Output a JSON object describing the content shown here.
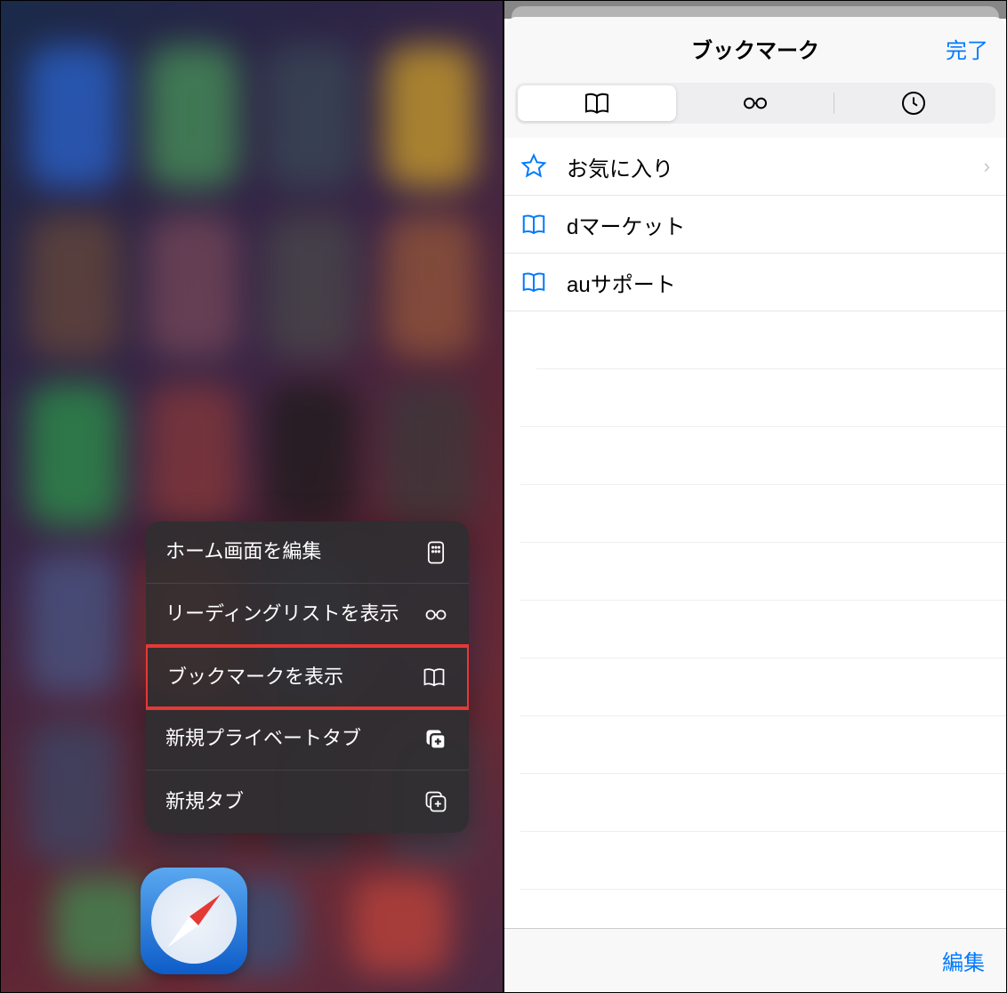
{
  "contextMenu": {
    "items": [
      {
        "label": "ホーム画面を編集",
        "icon": "home-grid"
      },
      {
        "label": "リーディングリストを表示",
        "icon": "glasses"
      },
      {
        "label": "ブックマークを表示",
        "icon": "book",
        "highlighted": true
      },
      {
        "label": "新規プライベートタブ",
        "icon": "tabs-plus-fill"
      },
      {
        "label": "新規タブ",
        "icon": "tabs-plus"
      }
    ]
  },
  "bookmarks": {
    "title": "ブックマーク",
    "done": "完了",
    "tabs": [
      "book",
      "glasses",
      "clock"
    ],
    "items": [
      {
        "label": "お気に入り",
        "icon": "star",
        "chevron": true
      },
      {
        "label": "dマーケット",
        "icon": "book"
      },
      {
        "label": "auサポート",
        "icon": "book"
      }
    ],
    "edit": "編集"
  }
}
